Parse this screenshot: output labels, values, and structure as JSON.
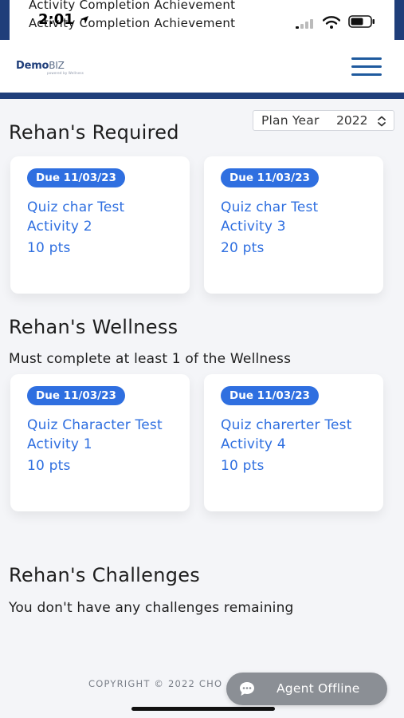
{
  "status_bar": {
    "overlay_line_1": "Activity Completion Achievement",
    "overlay_line_2": "Activity Completion Achievement",
    "time": "2:01",
    "icons": [
      "cellular-signal-icon",
      "wifi-icon",
      "battery-icon",
      "location-arrow-icon"
    ]
  },
  "header": {
    "logo_main": "Demo",
    "logo_accent": "BIZ",
    "logo_sub": "powered by Wellness",
    "menu_icon": "hamburger-menu-icon",
    "brand_color": "#1f3e7a"
  },
  "plan_year": {
    "label": "Plan Year",
    "value": "2022"
  },
  "required": {
    "heading": "Rehan's Required",
    "cards": [
      {
        "due": "Due 11/03/23",
        "title": "Quiz char Test Activity 2",
        "points": "10 pts"
      },
      {
        "due": "Due 11/03/23",
        "title": "Quiz char Test Activity 3",
        "points": "20 pts"
      }
    ]
  },
  "wellness": {
    "heading": "Rehan's Wellness",
    "note": "Must complete at least 1 of the Wellness",
    "cards": [
      {
        "due": "Due 11/03/23",
        "title": "Quiz Character Test Activity 1",
        "points": "10 pts"
      },
      {
        "due": "Due 11/03/23",
        "title": "Quiz charerter Test Activity 4",
        "points": "10 pts"
      }
    ]
  },
  "challenges": {
    "heading": "Rehan's Challenges",
    "empty_message": "You don't have any challenges remaining"
  },
  "footer": {
    "copyright": "COPYRIGHT © 2022 CHO"
  },
  "chat": {
    "label": "Agent Offline",
    "icon": "chat-bubble-icon"
  },
  "colors": {
    "accent": "#2f6fe0",
    "background": "#f4f5f8",
    "chat_bg": "#8b8f95"
  }
}
